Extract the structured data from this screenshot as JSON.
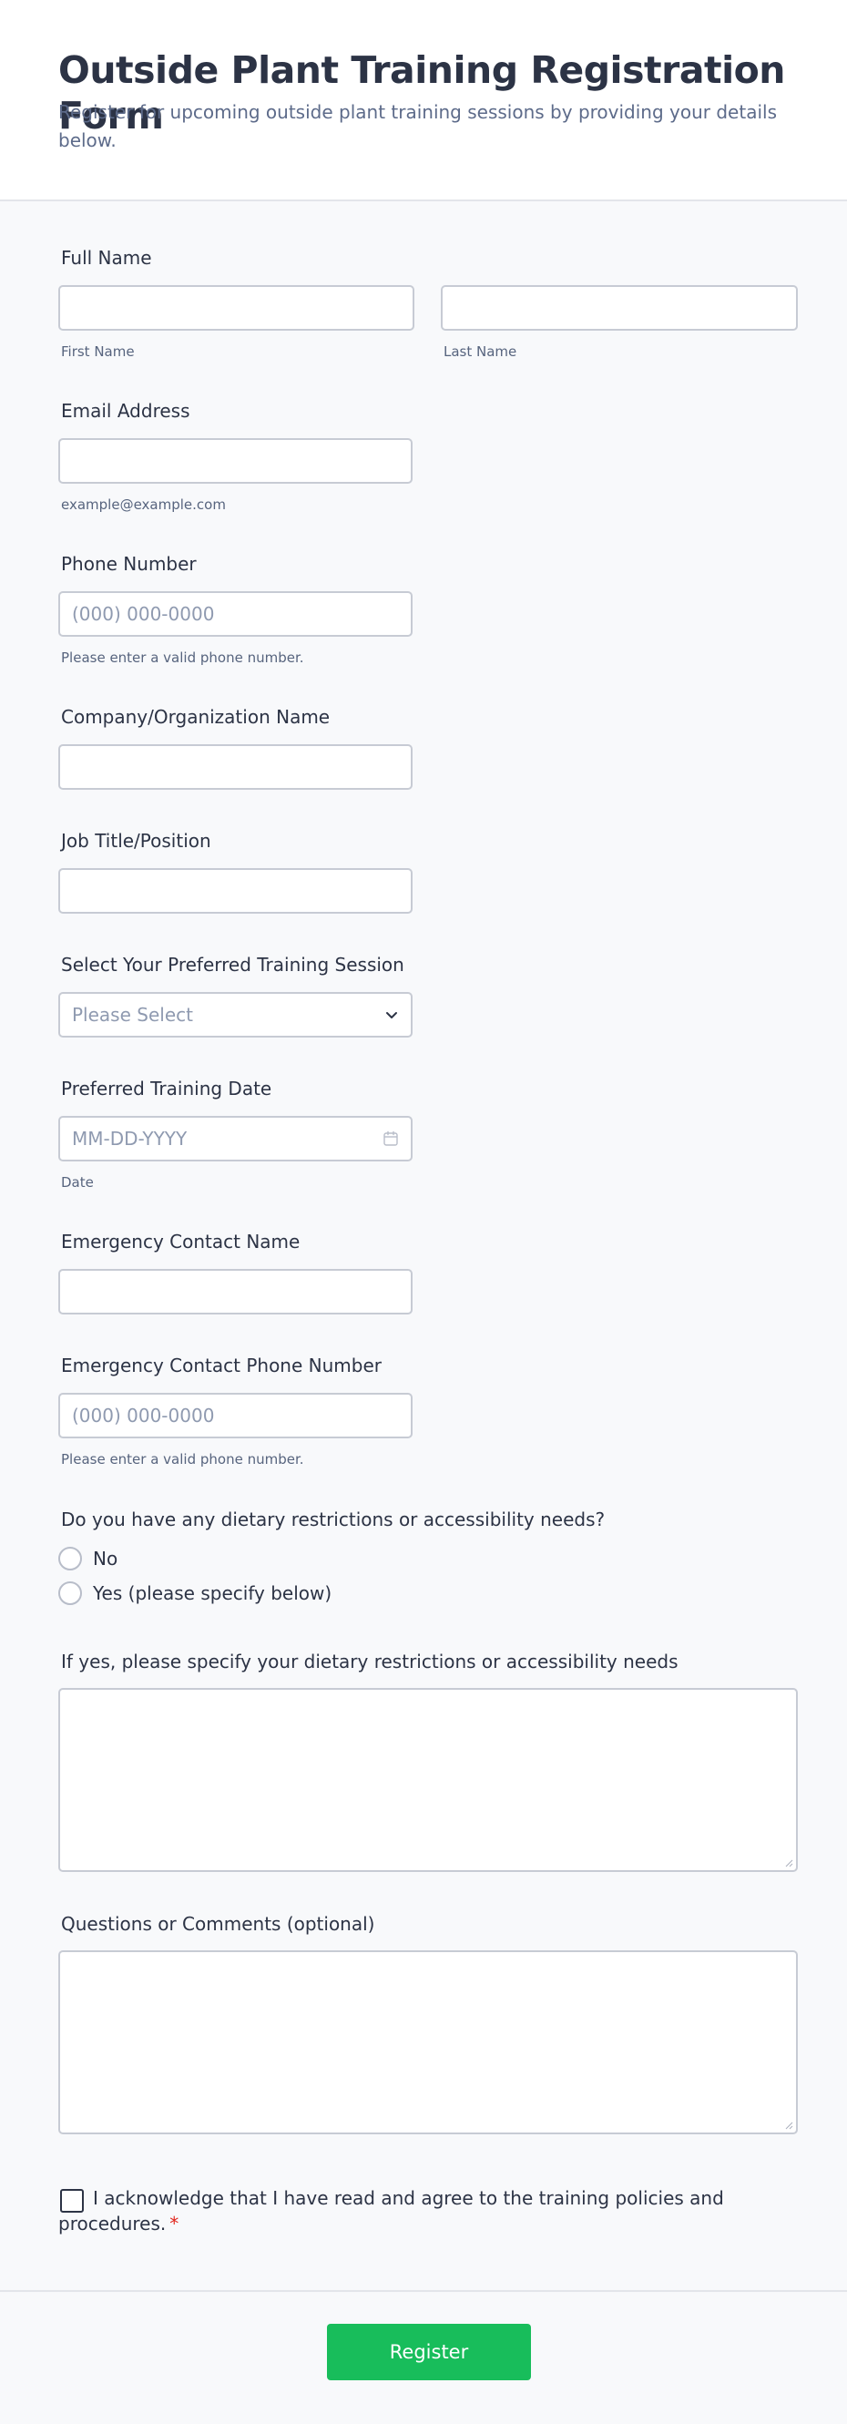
{
  "header": {
    "title": "Outside Plant Training Registration Form",
    "subtitle": "Register for upcoming outside plant training sessions by providing your details below."
  },
  "full_name": {
    "label": "Full Name",
    "first_sublabel": "First Name",
    "last_sublabel": "Last Name"
  },
  "email": {
    "label": "Email Address",
    "sublabel": "example@example.com"
  },
  "phone": {
    "label": "Phone Number",
    "placeholder": "(000) 000-0000",
    "sublabel": "Please enter a valid phone number."
  },
  "company": {
    "label": "Company/Organization Name"
  },
  "job_title": {
    "label": "Job Title/Position"
  },
  "session": {
    "label": "Select Your Preferred Training Session",
    "selected": "Please Select"
  },
  "date": {
    "label": "Preferred Training Date",
    "placeholder": "MM-DD-YYYY",
    "sublabel": "Date"
  },
  "emergency_name": {
    "label": "Emergency Contact Name"
  },
  "emergency_phone": {
    "label": "Emergency Contact Phone Number",
    "placeholder": "(000) 000-0000",
    "sublabel": "Please enter a valid phone number."
  },
  "dietary": {
    "label": "Do you have any dietary restrictions or accessibility needs?",
    "options": [
      "No",
      "Yes (please specify below)"
    ]
  },
  "specify": {
    "label": "If yes, please specify your dietary restrictions or accessibility needs"
  },
  "comments": {
    "label": "Questions or Comments (optional)"
  },
  "acknowledge": {
    "text": "I acknowledge that I have read and agree to the training policies and procedures.",
    "required_mark": "*"
  },
  "submit": {
    "label": "Register"
  },
  "colors": {
    "accent": "#18bd5b",
    "required": "#e1261c",
    "text": "#2c3345",
    "muted": "#5d6b8a",
    "border": "#c7cbd4"
  }
}
